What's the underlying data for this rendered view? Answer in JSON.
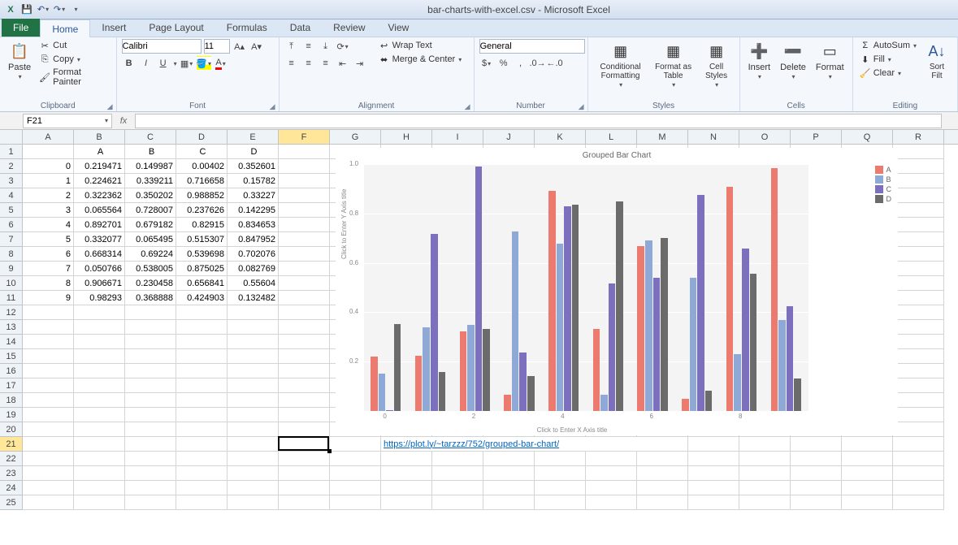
{
  "window_title": "bar-charts-with-excel.csv - Microsoft Excel",
  "tabs": {
    "file": "File",
    "home": "Home",
    "insert": "Insert",
    "pagelayout": "Page Layout",
    "formulas": "Formulas",
    "data": "Data",
    "review": "Review",
    "view": "View"
  },
  "ribbon": {
    "clipboard": {
      "paste": "Paste",
      "cut": "Cut",
      "copy": "Copy",
      "fp": "Format Painter",
      "label": "Clipboard"
    },
    "font": {
      "name": "Calibri",
      "size": "11",
      "label": "Font",
      "bold": "B",
      "italic": "I",
      "underline": "U"
    },
    "alignment": {
      "wrap": "Wrap Text",
      "merge": "Merge & Center",
      "label": "Alignment"
    },
    "number": {
      "format": "General",
      "label": "Number"
    },
    "styles": {
      "cond": "Conditional Formatting",
      "fmt": "Format as Table",
      "cell": "Cell Styles",
      "label": "Styles"
    },
    "cells": {
      "insert": "Insert",
      "delete": "Delete",
      "format": "Format",
      "label": "Cells"
    },
    "editing": {
      "autosum": "AutoSum",
      "fill": "Fill",
      "clear": "Clear",
      "sort": "Sort Filt",
      "label": "Editing"
    }
  },
  "namebox": "F21",
  "columns": [
    "A",
    "B",
    "C",
    "D",
    "E",
    "F",
    "G",
    "H",
    "I",
    "J",
    "K",
    "L",
    "M",
    "N",
    "O",
    "P",
    "Q",
    "R"
  ],
  "table_headers": [
    "",
    "A",
    "B",
    "C",
    "D"
  ],
  "table_rows": [
    [
      "0",
      "0.219471",
      "0.149987",
      "0.00402",
      "0.352601"
    ],
    [
      "1",
      "0.224621",
      "0.339211",
      "0.716658",
      "0.15782"
    ],
    [
      "2",
      "0.322362",
      "0.350202",
      "0.988852",
      "0.33227"
    ],
    [
      "3",
      "0.065564",
      "0.728007",
      "0.237626",
      "0.142295"
    ],
    [
      "4",
      "0.892701",
      "0.679182",
      "0.82915",
      "0.834653"
    ],
    [
      "5",
      "0.332077",
      "0.065495",
      "0.515307",
      "0.847952"
    ],
    [
      "6",
      "0.668314",
      "0.69224",
      "0.539698",
      "0.702076"
    ],
    [
      "7",
      "0.050766",
      "0.538005",
      "0.875025",
      "0.082769"
    ],
    [
      "8",
      "0.906671",
      "0.230458",
      "0.656841",
      "0.55604"
    ],
    [
      "9",
      "0.98293",
      "0.368888",
      "0.424903",
      "0.132482"
    ]
  ],
  "link_row": 21,
  "link_text": "https://plot.ly/~tarzzz/752/grouped-bar-chart/",
  "chart_data": {
    "type": "bar",
    "title": "Grouped Bar Chart",
    "xlabel": "Click to Enter X Axis title",
    "ylabel": "Click to Enter Y Axis title",
    "categories": [
      "0",
      "1",
      "2",
      "3",
      "4",
      "5",
      "6",
      "7",
      "8",
      "9"
    ],
    "series": [
      {
        "name": "A",
        "color": "#ec7a6e",
        "values": [
          0.219471,
          0.224621,
          0.322362,
          0.065564,
          0.892701,
          0.332077,
          0.668314,
          0.050766,
          0.906671,
          0.98293
        ]
      },
      {
        "name": "B",
        "color": "#8fa9d6",
        "values": [
          0.149987,
          0.339211,
          0.350202,
          0.728007,
          0.679182,
          0.065495,
          0.69224,
          0.538005,
          0.230458,
          0.368888
        ]
      },
      {
        "name": "C",
        "color": "#7b6fbe",
        "values": [
          0.00402,
          0.716658,
          0.988852,
          0.237626,
          0.82915,
          0.515307,
          0.539698,
          0.875025,
          0.656841,
          0.424903
        ]
      },
      {
        "name": "D",
        "color": "#6b6b6b",
        "values": [
          0.352601,
          0.15782,
          0.33227,
          0.142295,
          0.834653,
          0.847952,
          0.702076,
          0.082769,
          0.55604,
          0.132482
        ]
      }
    ],
    "ylim": [
      0,
      1
    ],
    "yticks": [
      0.2,
      0.4,
      0.6,
      0.8,
      1.0
    ],
    "xticks_shown": [
      "0",
      "2",
      "4",
      "6",
      "8"
    ]
  }
}
